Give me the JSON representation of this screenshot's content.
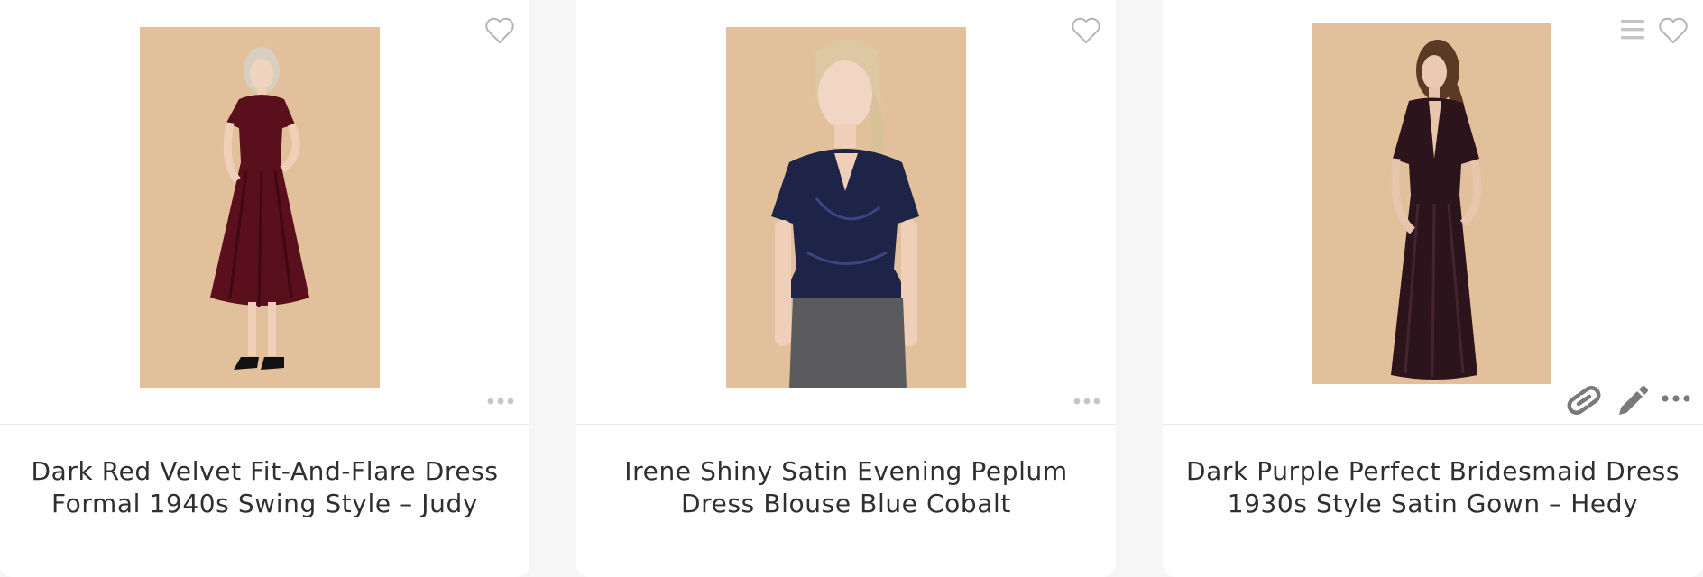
{
  "products": [
    {
      "title_line1": "Dark Red Velvet Fit-And-Flare Dress",
      "title_line2": "Formal 1940s Swing Style – Judy",
      "image_desc": "dark-red-velvet-dress-photo"
    },
    {
      "title_line1": "Irene Shiny Satin Evening Peplum",
      "title_line2": "Dress Blouse Blue Cobalt",
      "image_desc": "navy-satin-peplum-blouse-photo"
    },
    {
      "title_line1": "Dark Purple Perfect Bridesmaid Dress",
      "title_line2": "1930s Style Satin Gown – Hedy",
      "image_desc": "dark-purple-satin-gown-photo"
    }
  ],
  "icons": {
    "favorite": "heart-outline-icon",
    "more": "more-dots-icon",
    "link": "link-icon",
    "edit": "pencil-icon",
    "list": "list-icon"
  },
  "colors": {
    "photo_background": "#e2c09b",
    "title_text": "#2f2f2f",
    "icon_gray": "#b4b4b4",
    "icon_dark": "#7a7a7a"
  }
}
